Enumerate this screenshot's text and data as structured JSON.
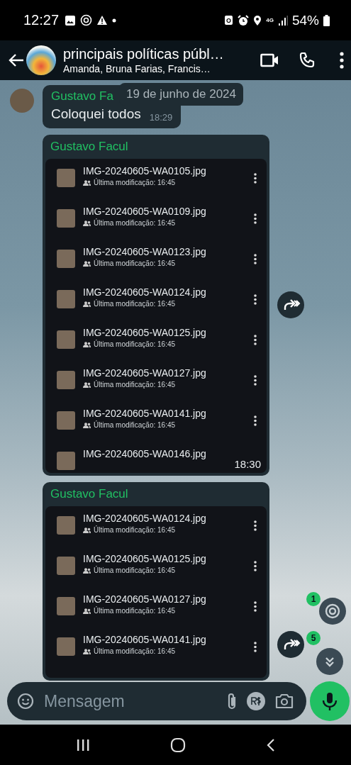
{
  "status_bar": {
    "time": "12:27",
    "network": "4G",
    "battery": "54%"
  },
  "header": {
    "title": "principais políticas públ…",
    "subtitle": "Amanda, Bruna Farias, Francis…"
  },
  "date_chip": "19 de junho de 2024",
  "messages": [
    {
      "kind": "text",
      "sender": "Gustavo Fa",
      "show_avatar": true,
      "text": "Coloquei todos",
      "time": "18:29"
    },
    {
      "kind": "files",
      "sender": "Gustavo Facul",
      "time": "18:30",
      "files": [
        {
          "name": "IMG-20240605-WA0105.jpg",
          "detail": "Última modificação: 16:45"
        },
        {
          "name": "IMG-20240605-WA0109.jpg",
          "detail": "Última modificação: 16:45"
        },
        {
          "name": "IMG-20240605-WA0123.jpg",
          "detail": "Última modificação: 16:45"
        },
        {
          "name": "IMG-20240605-WA0124.jpg",
          "detail": "Última modificação: 16:45"
        },
        {
          "name": "IMG-20240605-WA0125.jpg",
          "detail": "Última modificação: 16:45"
        },
        {
          "name": "IMG-20240605-WA0127.jpg",
          "detail": "Última modificação: 16:45"
        },
        {
          "name": "IMG-20240605-WA0141.jpg",
          "detail": "Última modificação: 16:45"
        },
        {
          "name": "IMG-20240605-WA0146.jpg"
        }
      ]
    },
    {
      "kind": "files",
      "sender": "Gustavo Facul",
      "files": [
        {
          "name": "IMG-20240605-WA0124.jpg",
          "detail": "Última modificação: 16:45"
        },
        {
          "name": "IMG-20240605-WA0125.jpg",
          "detail": "Última modificação: 16:45"
        },
        {
          "name": "IMG-20240605-WA0127.jpg",
          "detail": "Última modificação: 16:45"
        },
        {
          "name": "IMG-20240605-WA0141.jpg",
          "detail": "Última modificação: 16:45"
        }
      ]
    }
  ],
  "mention_badge": "1",
  "unread_badge": "5",
  "composer": {
    "placeholder": "Mensagem"
  }
}
